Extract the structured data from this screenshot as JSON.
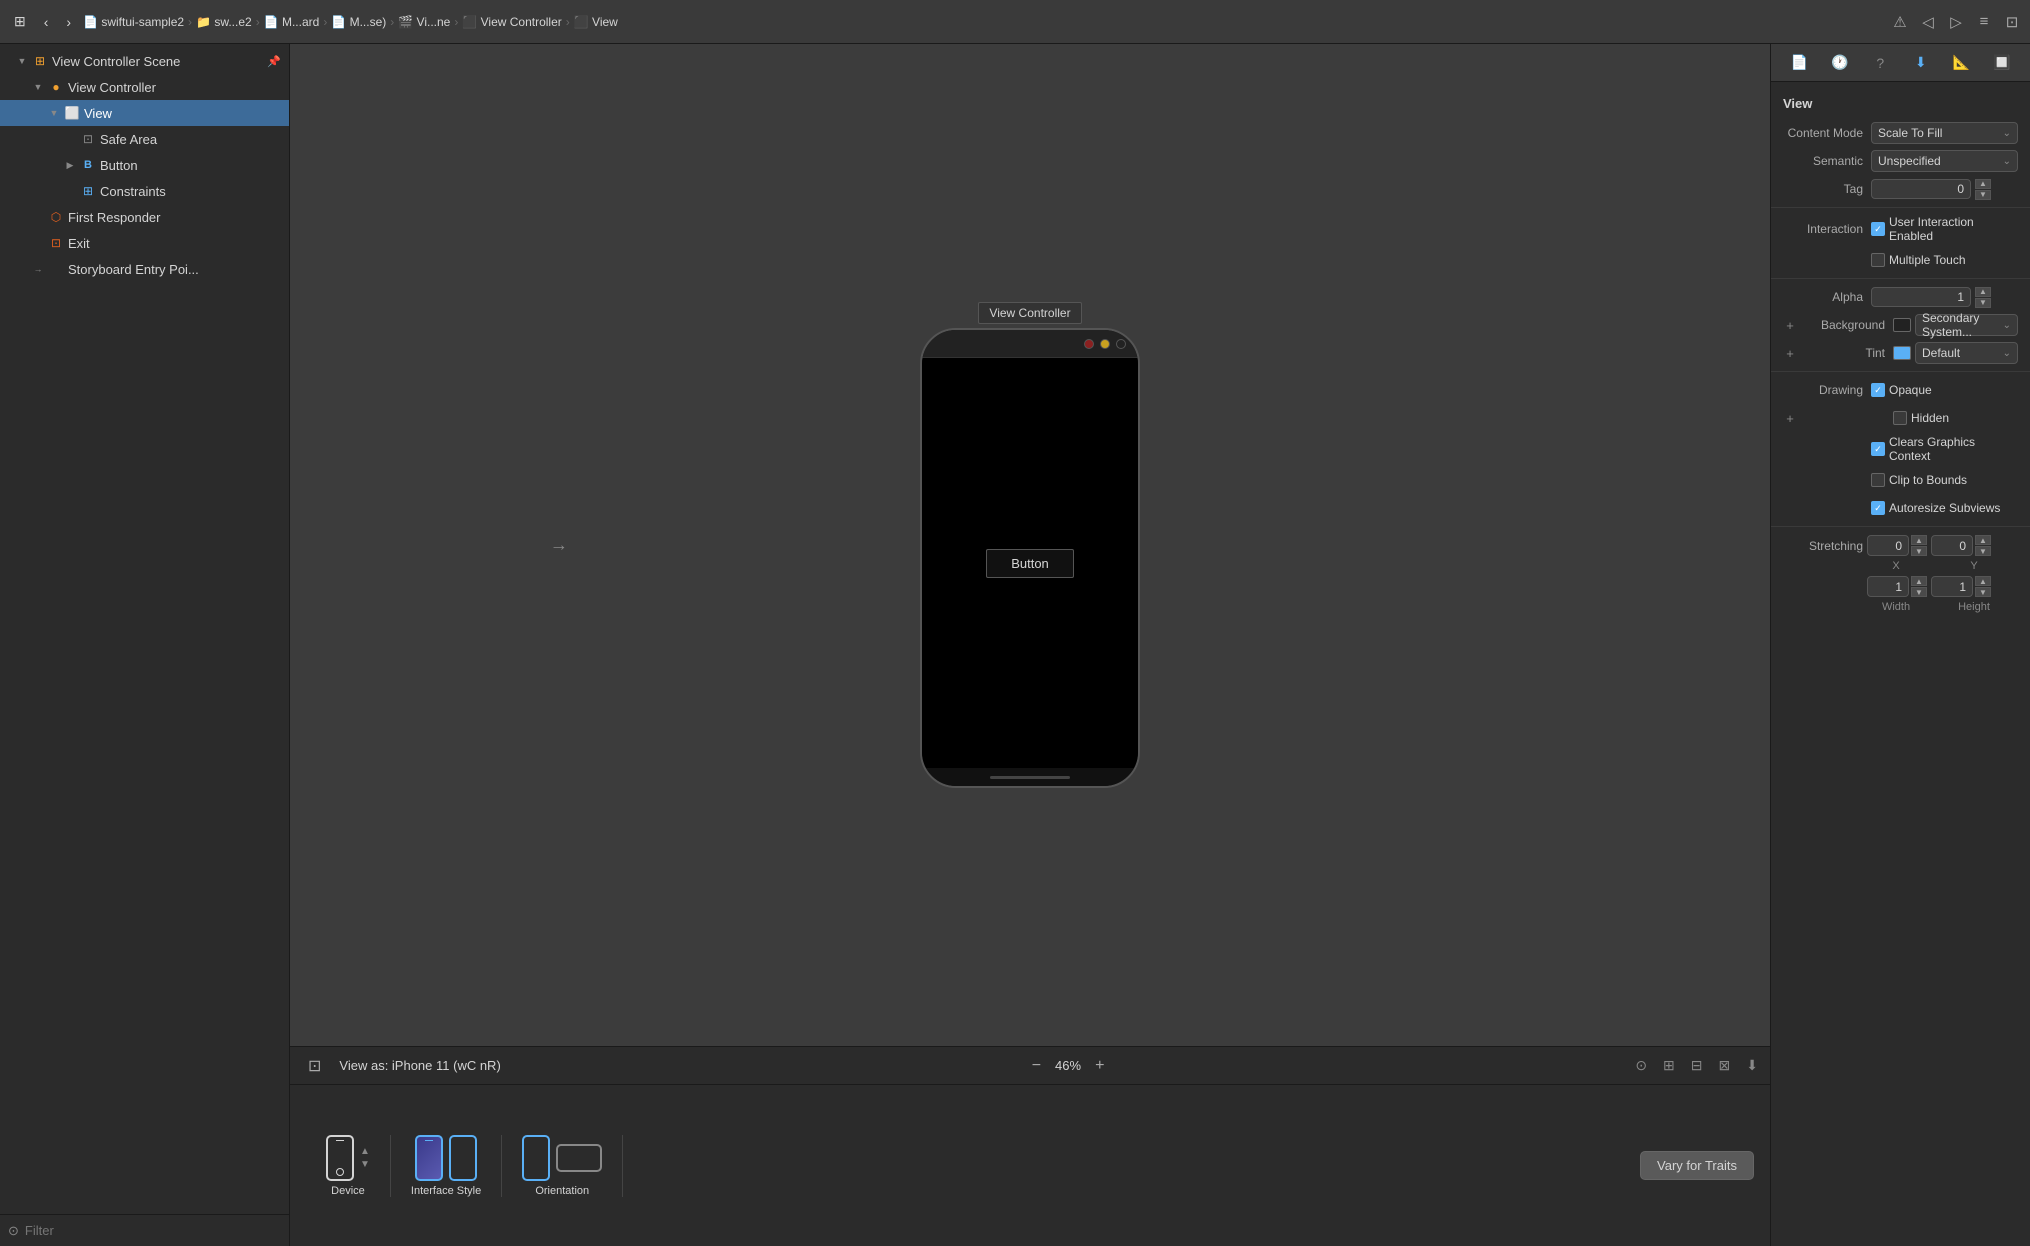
{
  "toolbar": {
    "back_btn": "‹",
    "forward_btn": "›",
    "breadcrumbs": [
      {
        "label": "swiftui-sample2"
      },
      {
        "label": "sw...e2"
      },
      {
        "label": "M...ard"
      },
      {
        "label": "M...se)"
      },
      {
        "label": "Vi...ne"
      },
      {
        "label": "View Controller"
      },
      {
        "label": "View"
      }
    ],
    "grid_icon": "⊞",
    "nav_icons": [
      "◁",
      "▷",
      "≡",
      "⊡"
    ]
  },
  "sidebar": {
    "filter_placeholder": "Filter",
    "items": [
      {
        "id": "view-controller-scene",
        "label": "View Controller Scene",
        "level": 0,
        "icon": "▼",
        "type": "scene",
        "has_pin": true
      },
      {
        "id": "view-controller",
        "label": "View Controller",
        "level": 1,
        "icon": "▼",
        "type": "vc"
      },
      {
        "id": "view",
        "label": "View",
        "level": 2,
        "icon": "▼",
        "type": "view",
        "selected": true
      },
      {
        "id": "safe-area",
        "label": "Safe Area",
        "level": 3,
        "icon": "",
        "type": "safe"
      },
      {
        "id": "button",
        "label": "Button",
        "level": 3,
        "icon": "▶",
        "type": "button"
      },
      {
        "id": "constraints",
        "label": "Constraints",
        "level": 3,
        "icon": "■",
        "type": "constraints"
      },
      {
        "id": "first-responder",
        "label": "First Responder",
        "level": 1,
        "icon": "",
        "type": "first"
      },
      {
        "id": "exit",
        "label": "Exit",
        "level": 1,
        "icon": "",
        "type": "exit"
      },
      {
        "id": "storyboard-entry",
        "label": "Storyboard Entry Poi...",
        "level": 1,
        "icon": "→",
        "type": "entry"
      }
    ]
  },
  "canvas": {
    "scene_label": "View Controller",
    "button_label": "Button",
    "zoom_label": "46%",
    "zoom_minus": "−",
    "zoom_plus": "+",
    "status_text": "View as: iPhone 11 (wC nR)"
  },
  "bottom_bar": {
    "device_label": "Device",
    "interface_label": "Interface Style",
    "orientation_label": "Orientation",
    "vary_label": "Vary for Traits"
  },
  "right_panel": {
    "title": "View",
    "tabs": [
      "📄",
      "🕐",
      "❓",
      "⬇",
      "📱",
      "🔲"
    ],
    "content_mode": {
      "label": "Content Mode",
      "value": "Scale To Fill"
    },
    "semantic": {
      "label": "Semantic",
      "value": "Unspecified"
    },
    "tag": {
      "label": "Tag",
      "value": "0"
    },
    "interaction": {
      "label": "Interaction",
      "user_enabled": "User Interaction Enabled",
      "user_checked": true,
      "multi_touch": "Multiple Touch",
      "multi_checked": false
    },
    "alpha": {
      "label": "Alpha",
      "value": "1"
    },
    "background": {
      "label": "Background",
      "value": "Secondary System..."
    },
    "tint": {
      "label": "Tint",
      "value": "Default"
    },
    "drawing": {
      "label": "Drawing",
      "opaque_label": "Opaque",
      "opaque_checked": true,
      "hidden_label": "Hidden",
      "hidden_checked": false,
      "clears_label": "Clears Graphics Context",
      "clears_checked": true,
      "clip_label": "Clip to Bounds",
      "clip_checked": false,
      "autoresize_label": "Autoresize Subviews",
      "autoresize_checked": true
    },
    "stretching": {
      "label": "Stretching",
      "x_val": "0",
      "y_val": "0",
      "w_val": "1",
      "h_val": "1",
      "x_label": "X",
      "y_label": "Y",
      "w_label": "Width",
      "h_label": "Height"
    }
  }
}
